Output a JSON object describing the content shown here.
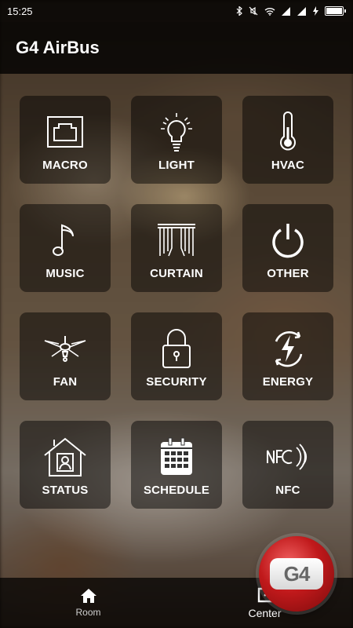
{
  "status_bar": {
    "time": "15:25",
    "icons": [
      "bluetooth-icon",
      "mute-icon",
      "wifi-icon",
      "signal-icon",
      "signal-icon",
      "charging-icon",
      "battery-icon"
    ]
  },
  "app": {
    "title": "G4 AirBus"
  },
  "tiles": [
    {
      "label": "MACRO",
      "icon": "network-port-icon"
    },
    {
      "label": "LIGHT",
      "icon": "light-bulb-icon"
    },
    {
      "label": "HVAC",
      "icon": "thermometer-icon"
    },
    {
      "label": "MUSIC",
      "icon": "music-note-icon"
    },
    {
      "label": "CURTAIN",
      "icon": "curtain-icon"
    },
    {
      "label": "OTHER",
      "icon": "power-icon"
    },
    {
      "label": "FAN",
      "icon": "ceiling-fan-icon"
    },
    {
      "label": "SECURITY",
      "icon": "padlock-icon"
    },
    {
      "label": "ENERGY",
      "icon": "energy-bolt-icon"
    },
    {
      "label": "STATUS",
      "icon": "home-user-icon"
    },
    {
      "label": "SCHEDULE",
      "icon": "calendar-icon"
    },
    {
      "label": "NFC",
      "icon": "nfc-icon"
    }
  ],
  "bottom_nav": {
    "room": {
      "label": "Room",
      "icon": "home-icon"
    },
    "center": {
      "label": "Center",
      "icon": "external-link-icon"
    }
  },
  "badge": {
    "text": "G4",
    "color": "#c0191b"
  }
}
